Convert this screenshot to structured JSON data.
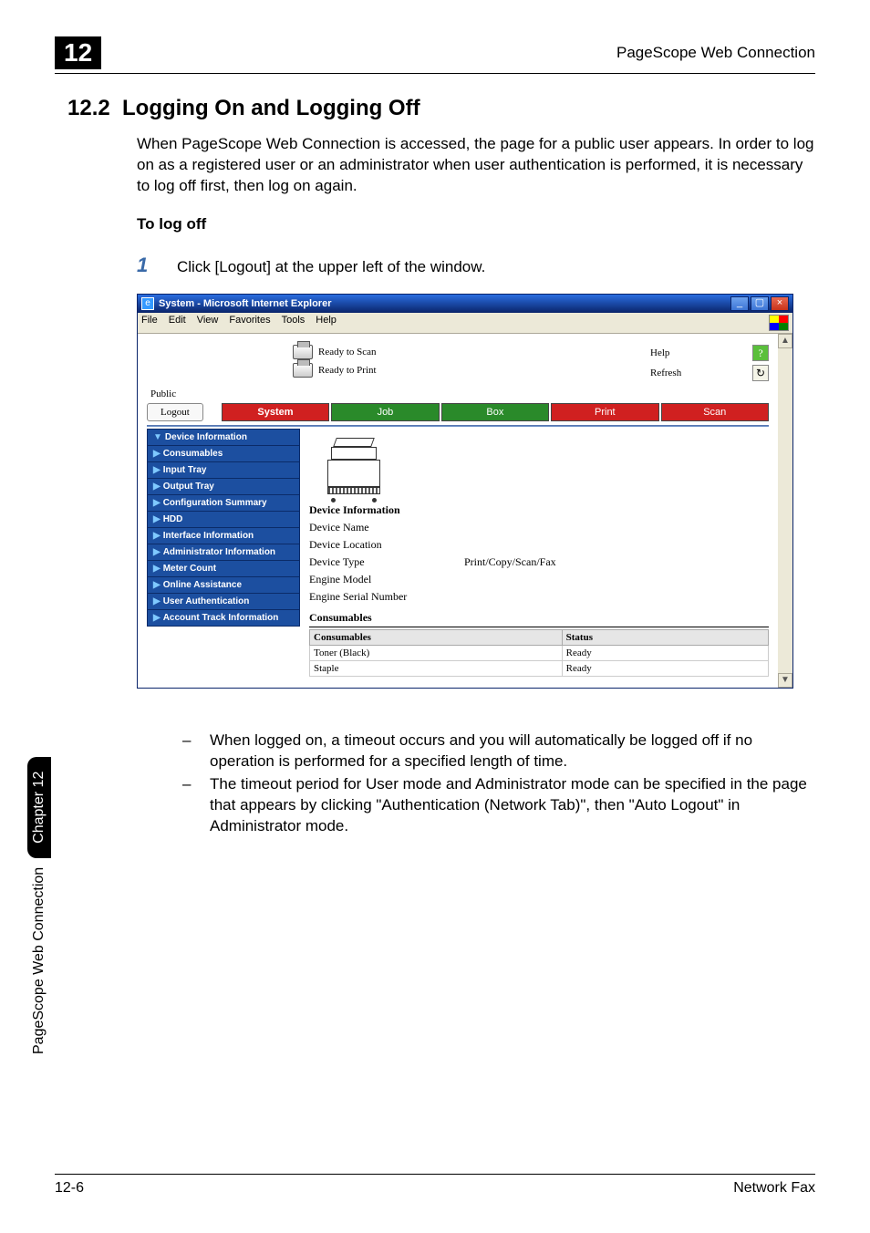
{
  "header": {
    "chapter_number": "12",
    "title": "PageScope Web Connection"
  },
  "section": {
    "number": "12.2",
    "title": "Logging On and Logging Off",
    "intro": "When PageScope Web Connection is accessed, the page for a public user appears. In order to log on as a registered user or an administrator when user authentication is performed, it is necessary to log off first, then log on again.",
    "subheading": "To log off"
  },
  "step": {
    "number": "1",
    "text": "Click [Logout] at the upper left of the window."
  },
  "ie": {
    "title": "System - Microsoft Internet Explorer",
    "menu": {
      "file": "File",
      "edit": "Edit",
      "view": "View",
      "favorites": "Favorites",
      "tools": "Tools",
      "help": "Help"
    },
    "win_min": "_",
    "win_max": "▢",
    "win_close": "×",
    "status": {
      "scan": "Ready to Scan",
      "print": "Ready to Print",
      "help": "Help",
      "refresh": "Refresh",
      "help_icon": "?",
      "refresh_icon": "↻"
    },
    "public_label": "Public",
    "logout_btn": "Logout",
    "tabs": {
      "system": "System",
      "job": "Job",
      "box": "Box",
      "print": "Print",
      "scan": "Scan"
    },
    "sidebar": [
      {
        "mark": "▼",
        "label": "Device Information"
      },
      {
        "mark": "▶",
        "label": "Consumables"
      },
      {
        "mark": "▶",
        "label": "Input Tray"
      },
      {
        "mark": "▶",
        "label": "Output Tray"
      },
      {
        "mark": "▶",
        "label": "Configuration Summary"
      },
      {
        "mark": "▶",
        "label": "HDD"
      },
      {
        "mark": "▶",
        "label": "Interface Information"
      },
      {
        "mark": "▶",
        "label": "Administrator Information"
      },
      {
        "mark": "▶",
        "label": "Meter Count"
      },
      {
        "mark": "▶",
        "label": "Online Assistance"
      },
      {
        "mark": "▶",
        "label": "User Authentication"
      },
      {
        "mark": "▶",
        "label": "Account Track Information"
      }
    ],
    "main": {
      "device_info_heading": "Device Information",
      "rows": {
        "name_k": "Device Name",
        "name_v": "",
        "loc_k": "Device Location",
        "loc_v": "",
        "type_k": "Device Type",
        "type_v": "Print/Copy/Scan/Fax",
        "model_k": "Engine Model",
        "model_v": "",
        "serial_k": "Engine Serial Number",
        "serial_v": ""
      },
      "consumables_heading": "Consumables",
      "cons_cols": {
        "c1": "Consumables",
        "c2": "Status"
      },
      "cons_rows": [
        {
          "name": "Toner (Black)",
          "status": "Ready"
        },
        {
          "name": "Staple",
          "status": "Ready"
        }
      ]
    }
  },
  "notes": {
    "n1": "When logged on, a timeout occurs and you will automatically be logged off if no operation is performed for a specified length of time.",
    "n2": "The timeout period for User mode and Administrator mode can be specified in the page that appears by clicking \"Authentication (Network Tab)\", then \"Auto Logout\" in Administrator mode."
  },
  "side_tab": {
    "text": "PageScope Web Connection",
    "pill": "Chapter 12"
  },
  "footer": {
    "left": "12-6",
    "right": "Network Fax"
  }
}
